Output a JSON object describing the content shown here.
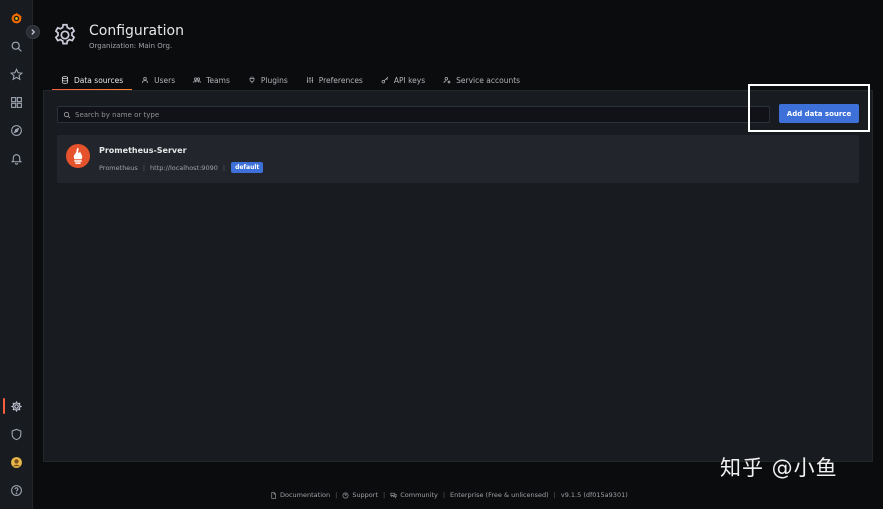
{
  "header": {
    "title": "Configuration",
    "subtitle": "Organization: Main Org."
  },
  "tabs": [
    {
      "label": "Data sources",
      "icon": "database-icon",
      "active": true
    },
    {
      "label": "Users",
      "icon": "user-icon",
      "active": false
    },
    {
      "label": "Teams",
      "icon": "users-icon",
      "active": false
    },
    {
      "label": "Plugins",
      "icon": "plug-icon",
      "active": false
    },
    {
      "label": "Preferences",
      "icon": "sliders-icon",
      "active": false
    },
    {
      "label": "API keys",
      "icon": "key-icon",
      "active": false
    },
    {
      "label": "Service accounts",
      "icon": "user-cog-icon",
      "active": false
    }
  ],
  "search": {
    "placeholder": "Search by name or type",
    "value": ""
  },
  "add_button": {
    "label": "Add data source"
  },
  "datasource": {
    "name": "Prometheus-Server",
    "type": "Prometheus",
    "url": "http://localhost:9090",
    "badge": "default"
  },
  "footer": {
    "documentation": "Documentation",
    "support": "Support",
    "community": "Community",
    "edition": "Enterprise (Free & unlicensed)",
    "version": "v9.1.5 (df015a9301)"
  },
  "watermark": "知乎 @小鱼",
  "colors": {
    "accent": "#f55f3e",
    "primary_button": "#3d71d9",
    "background": "#0b0c0e",
    "panel": "#181b1f"
  }
}
